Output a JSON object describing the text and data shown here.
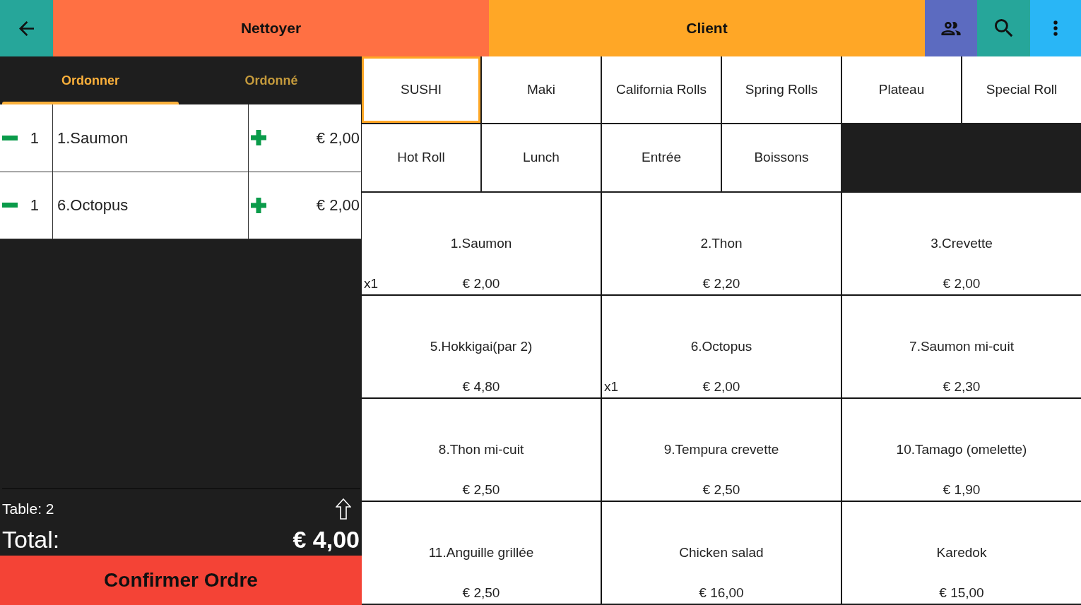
{
  "toolbar": {
    "clear_button": "Nettoyer",
    "client_button": "Client"
  },
  "order_tabs": [
    {
      "label": "Ordonner",
      "selected": true
    },
    {
      "label": "Ordonné",
      "selected": false
    }
  ],
  "order_lines": [
    {
      "quantity": "1",
      "name": "1.Saumon",
      "price": "€ 2,00"
    },
    {
      "quantity": "1",
      "name": "6.Octopus",
      "price": "€ 2,00"
    }
  ],
  "table_label": "Table: 2",
  "total": {
    "label": "Total:",
    "amount": "€ 4,00"
  },
  "confirm_button": "Confirmer Ordre",
  "categories": [
    {
      "label": "SUSHI",
      "selected": true
    },
    {
      "label": "Maki",
      "selected": false
    },
    {
      "label": "California Rolls",
      "selected": false
    },
    {
      "label": "Spring Rolls",
      "selected": false
    },
    {
      "label": "Plateau",
      "selected": false
    },
    {
      "label": "Special Roll",
      "selected": false
    },
    {
      "label": "Hot Roll",
      "selected": false
    },
    {
      "label": "Lunch",
      "selected": false
    },
    {
      "label": "Entrée",
      "selected": false
    },
    {
      "label": "Boissons",
      "selected": false
    }
  ],
  "products": [
    {
      "name": "1.Saumon",
      "price": "€ 2,00",
      "count": "x1"
    },
    {
      "name": "2.Thon",
      "price": "€ 2,20"
    },
    {
      "name": "3.Crevette",
      "price": "€ 2,00"
    },
    {
      "name": "5.Hokkigai(par 2)",
      "price": "€ 4,80"
    },
    {
      "name": "6.Octopus",
      "price": "€ 2,00",
      "count": "x1"
    },
    {
      "name": "7.Saumon mi-cuit",
      "price": "€ 2,30"
    },
    {
      "name": "8.Thon mi-cuit",
      "price": "€ 2,50"
    },
    {
      "name": "9.Tempura crevette",
      "price": "€ 2,50"
    },
    {
      "name": "10.Tamago (omelette)",
      "price": "€ 1,90"
    },
    {
      "name": "11.Anguille grillée",
      "price": "€ 2,50"
    },
    {
      "name": "Chicken salad",
      "price": "€ 16,00"
    },
    {
      "name": "Karedok",
      "price": "€ 15,00"
    }
  ]
}
